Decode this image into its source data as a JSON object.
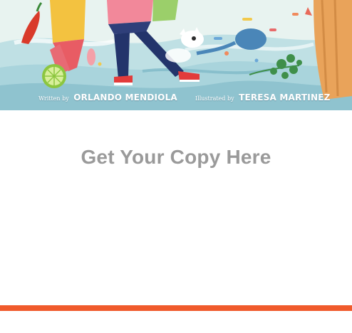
{
  "cover": {
    "author_prefix": "Written by",
    "author_name": "ORLANDO MENDIOLA",
    "illustrator_prefix": "Illustrated by",
    "illustrator_name": "TERESA MARTINEZ"
  },
  "main": {
    "headline": "Get Your Copy Here"
  },
  "colors": {
    "headline": "#9a9a9a",
    "accent_bar": "#f05a2b",
    "background": "#ffffff"
  }
}
